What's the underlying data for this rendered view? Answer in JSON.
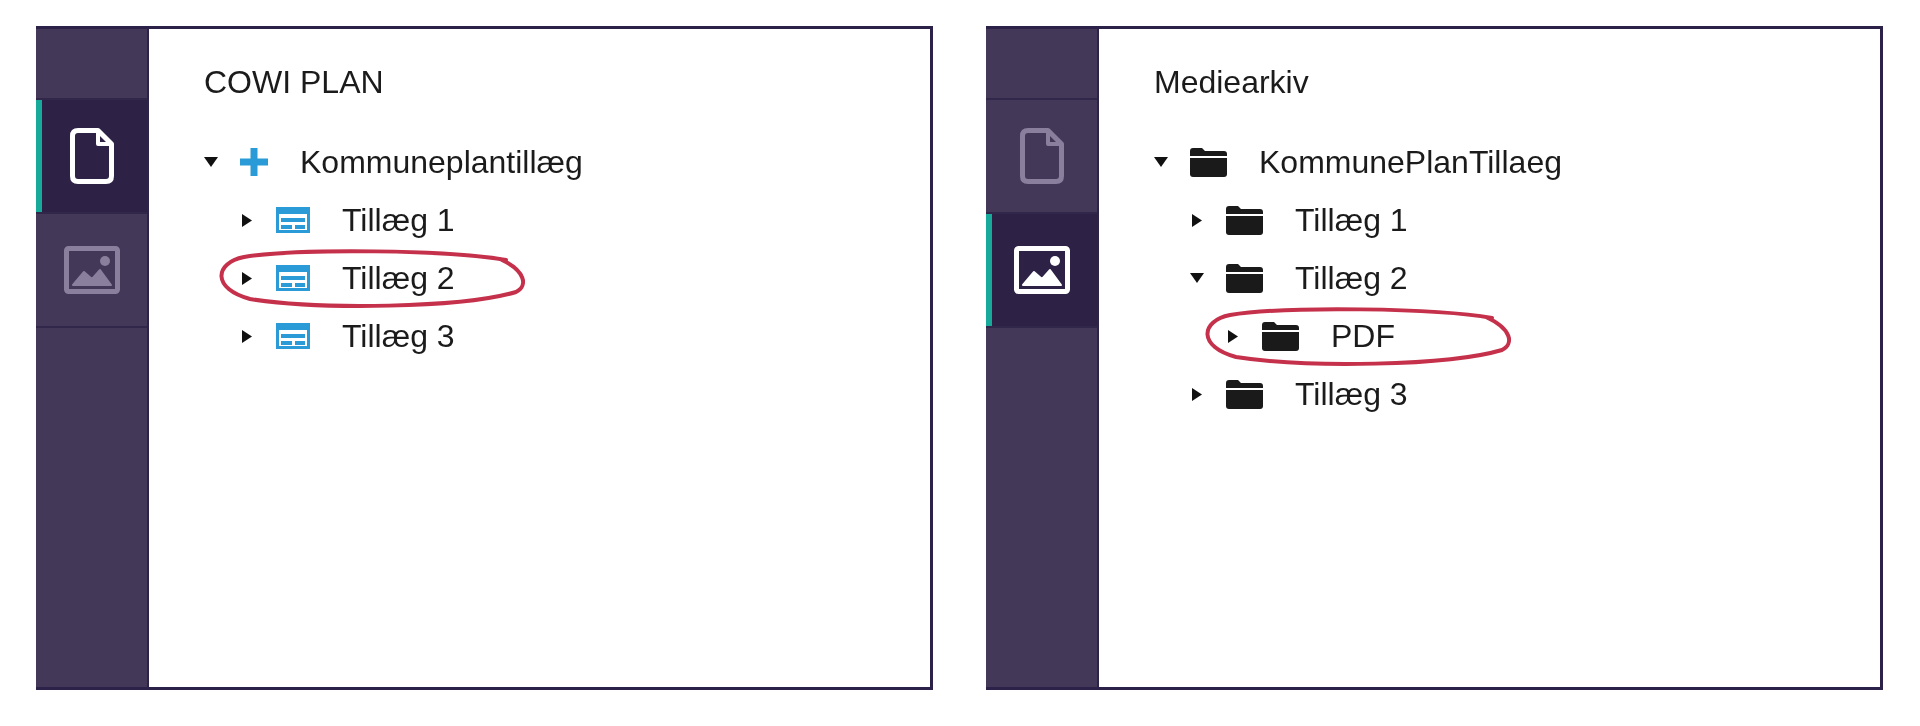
{
  "panels": [
    {
      "sidebar": {
        "tabs": [
          {
            "kind": "document",
            "selected": true
          },
          {
            "kind": "image",
            "selected": false
          }
        ]
      },
      "title": "COWI PLAN",
      "tree": [
        {
          "label": "Kommuneplantillæg",
          "kind": "plan",
          "expanded": true,
          "highlighted": false,
          "children": [
            {
              "label": "Tillæg 1",
              "kind": "addendum",
              "expanded": false,
              "highlighted": false
            },
            {
              "label": "Tillæg 2",
              "kind": "addendum",
              "expanded": false,
              "highlighted": true
            },
            {
              "label": "Tillæg 3",
              "kind": "addendum",
              "expanded": false,
              "highlighted": false
            }
          ]
        }
      ]
    },
    {
      "sidebar": {
        "tabs": [
          {
            "kind": "document",
            "selected": false
          },
          {
            "kind": "image",
            "selected": true
          }
        ]
      },
      "title": "Mediearkiv",
      "tree": [
        {
          "label": "KommunePlanTillaeg",
          "kind": "folder",
          "expanded": true,
          "highlighted": false,
          "children": [
            {
              "label": "Tillæg 1",
              "kind": "folder",
              "expanded": false,
              "highlighted": false
            },
            {
              "label": "Tillæg 2",
              "kind": "folder",
              "expanded": true,
              "highlighted": false,
              "children": [
                {
                  "label": "PDF",
                  "kind": "folder",
                  "expanded": false,
                  "highlighted": true
                }
              ]
            },
            {
              "label": "Tillæg 3",
              "kind": "folder",
              "expanded": false,
              "highlighted": false
            }
          ]
        }
      ]
    }
  ]
}
